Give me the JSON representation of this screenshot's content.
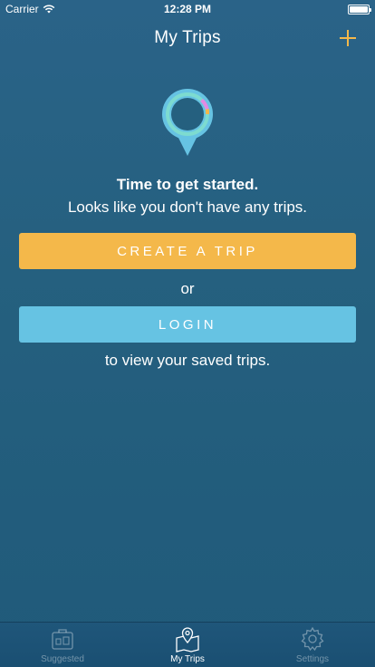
{
  "status_bar": {
    "carrier": "Carrier",
    "time": "12:28 PM"
  },
  "nav": {
    "title": "My Trips",
    "add_icon": "plus-icon"
  },
  "empty_state": {
    "heading": "Time to get started.",
    "subheading": "Looks like you don't have any trips.",
    "create_button": "CREATE A TRIP",
    "or_text": "or",
    "login_button": "LOGIN",
    "saved_text": "to view your saved trips."
  },
  "tabs": [
    {
      "label": "Suggested",
      "icon": "suitcase-icon",
      "active": false
    },
    {
      "label": "My Trips",
      "icon": "map-pin-icon",
      "active": true
    },
    {
      "label": "Settings",
      "icon": "gear-icon",
      "active": false
    }
  ],
  "colors": {
    "background": "#25607f",
    "create_button": "#f4b84a",
    "login_button": "#66c3e3",
    "accent_plus": "#f4b84a"
  }
}
